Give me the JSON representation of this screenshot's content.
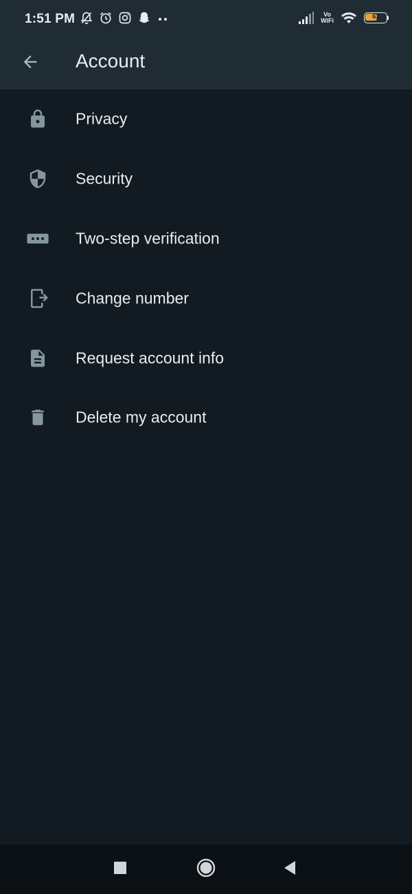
{
  "status_bar": {
    "time": "1:51 PM",
    "left_icons": [
      "muted-bell-icon",
      "alarm-clock-icon",
      "instagram-icon",
      "snapchat-icon",
      "more-dots-icon"
    ],
    "right_icons": [
      "signal-icon",
      "vowifi-icon",
      "wifi-icon",
      "battery-icon"
    ],
    "vowifi_top": "Vo",
    "vowifi_bottom": "WiFi",
    "battery_level": "62",
    "battery_fraction": 0.62
  },
  "app_bar": {
    "title": "Account",
    "back_icon": "arrow-left-icon"
  },
  "menu": {
    "items": [
      {
        "label": "Privacy",
        "icon": "lock-icon"
      },
      {
        "label": "Security",
        "icon": "shield-icon"
      },
      {
        "label": "Two-step verification",
        "icon": "password-dots-icon"
      },
      {
        "label": "Change number",
        "icon": "phone-transfer-icon"
      },
      {
        "label": "Request account info",
        "icon": "document-icon"
      },
      {
        "label": "Delete my account",
        "icon": "trash-icon"
      }
    ]
  },
  "nav_bar": {
    "buttons": [
      "recents-square-icon",
      "home-circle-icon",
      "back-triangle-icon"
    ]
  },
  "colors": {
    "background": "#121b22",
    "bar": "#1f2c34",
    "text": "#e9edef",
    "icon": "#8696a0",
    "battery_fill": "#f0a23a"
  }
}
